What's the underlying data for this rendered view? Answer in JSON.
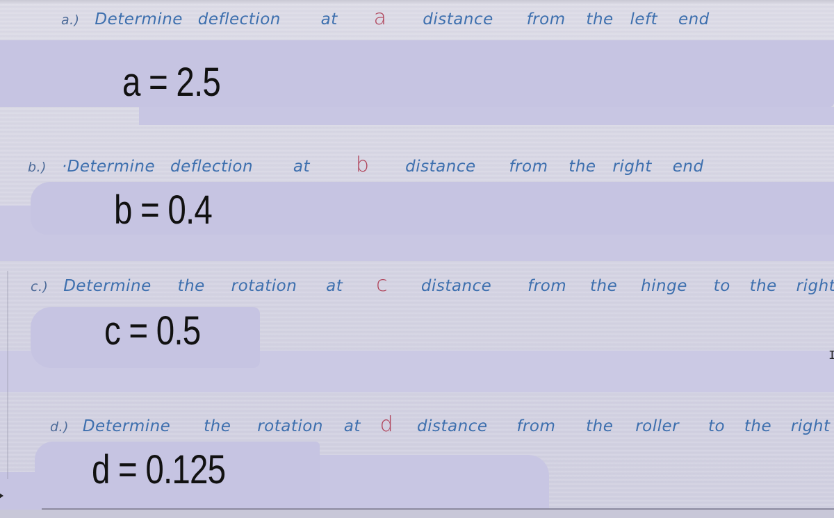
{
  "questions": [
    {
      "label": "a.)",
      "prompt_words": [
        "Determine",
        "deflection",
        "at"
      ],
      "variable": "a",
      "suffix_words": [
        "distance",
        "from",
        "the",
        "left",
        "end"
      ],
      "answer": "a = 2.5"
    },
    {
      "label": "b.)",
      "prompt_words": [
        "·Determine",
        "deflection",
        "at"
      ],
      "variable": "b",
      "suffix_words": [
        "distance",
        "from",
        "the",
        "right",
        "end"
      ],
      "answer": "b = 0.4"
    },
    {
      "label": "c.)",
      "prompt_words": [
        "Determine",
        "the",
        "rotation",
        "at"
      ],
      "variable": "c",
      "suffix_words": [
        "distance",
        "from",
        "the",
        "hinge",
        "to",
        "the",
        "right"
      ],
      "answer": "c = 0.5"
    },
    {
      "label": "d.)",
      "prompt_words": [
        "Determine",
        "the",
        "rotation",
        "at"
      ],
      "variable": "d",
      "suffix_words": [
        "distance",
        "from",
        "the",
        "roller",
        "to",
        "the",
        "right"
      ],
      "answer": "d = 0.125"
    }
  ],
  "cursor": {
    "text_cursor_glyph": "I"
  },
  "colors": {
    "handwriting_blue": "#3d6fae",
    "variable_red": "#b0435a",
    "answer_black": "#111111",
    "patch_lavender": "#c6c4e2",
    "paper": "#d7d6e3"
  }
}
